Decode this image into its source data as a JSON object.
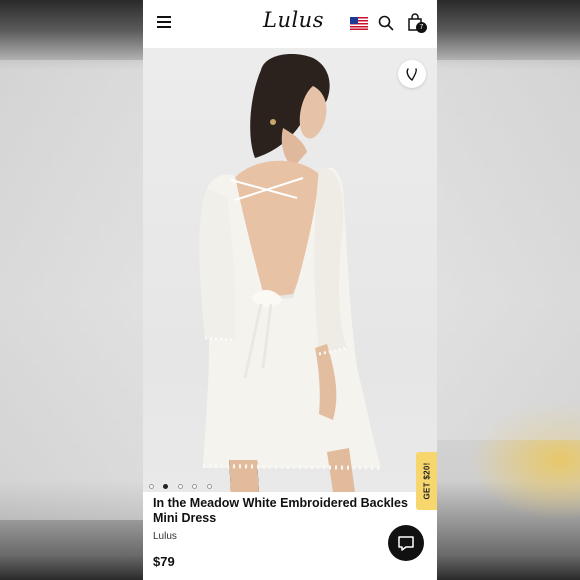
{
  "header": {
    "logo": "Lulus",
    "cart_count": "7",
    "icons": [
      "hamburger-menu-icon",
      "us-flag-icon",
      "search-icon",
      "shopping-bag-icon"
    ]
  },
  "gallery": {
    "slides_total": 5,
    "active_slide": 2,
    "favorite_icon": "heart-icon"
  },
  "promo": {
    "label": "GET $20!"
  },
  "product": {
    "title_line1": "In the Meadow White Embroidered Backles",
    "title_line2": "Mini Dress",
    "brand": "Lulus",
    "price": "$79"
  },
  "chat": {
    "icon": "chat-bubble-icon"
  },
  "colors": {
    "promo": "#f7d66e",
    "dress": "#f5f3ee",
    "dark": "#111111"
  }
}
